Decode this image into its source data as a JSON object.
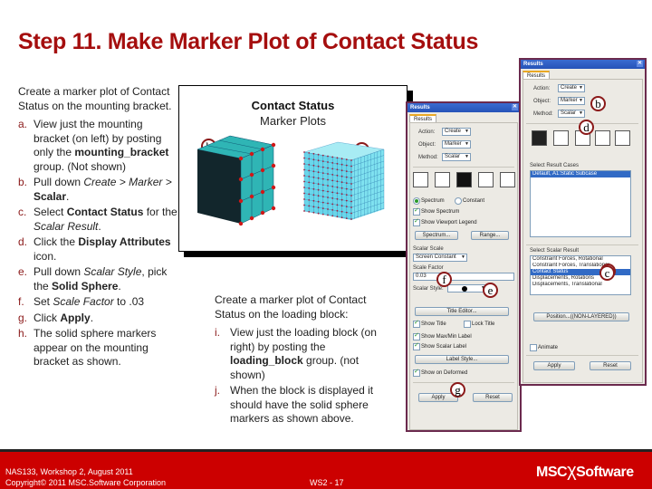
{
  "slide": {
    "title": "Step 11. Make Marker Plot of Contact Status"
  },
  "left": {
    "intro": "Create a marker plot of Contact Status on the mounting bracket.",
    "steps": [
      {
        "letter": "a.",
        "parts": [
          "View just the mounting bracket (on left) by posting only the ",
          "mounting_bracket",
          " group. (Not shown)"
        ]
      },
      {
        "letter": "b.",
        "parts": [
          "Pull down ",
          "Create > Marker >",
          " ",
          "Scalar",
          "."
        ]
      },
      {
        "letter": "c.",
        "parts": [
          "Select ",
          "Contact Status",
          " for the ",
          "Scalar Result",
          "."
        ]
      },
      {
        "letter": "d.",
        "parts": [
          "Click the ",
          "Display Attributes",
          " icon."
        ]
      },
      {
        "letter": "e.",
        "parts": [
          "Pull down ",
          "Scalar Style",
          ", pick the ",
          "Solid Sphere",
          "."
        ]
      },
      {
        "letter": "f.",
        "parts": [
          "Set ",
          "Scale Factor",
          " to .03"
        ]
      },
      {
        "letter": "g.",
        "parts": [
          "Click ",
          "Apply",
          "."
        ]
      },
      {
        "letter": "h.",
        "parts": [
          "The solid sphere markers appear on the mounting bracket as shown."
        ]
      }
    ]
  },
  "figure": {
    "title": "Contact Status",
    "subtitle": "Marker Plots",
    "callout_h": "h",
    "callout_i": "i"
  },
  "right": {
    "intro": "Create a marker plot of Contact Status on the loading block:",
    "steps": [
      {
        "letter": "i.",
        "parts": [
          "View just the loading block (on right) by posting the ",
          "loading_block",
          " group. (not shown)"
        ]
      },
      {
        "letter": "j.",
        "parts": [
          "When the block is displayed it should have the solid sphere markers as shown above."
        ]
      }
    ]
  },
  "panel_front": {
    "window_title": "Results",
    "tab": "Results",
    "action_label": "Action:",
    "action_value": "Create",
    "object_label": "Object:",
    "object_value": "Marker",
    "method_label": "Method:",
    "method_value": "Scalar",
    "result_cases_label": "Select Result Cases",
    "result_cases": [
      "Default, A1:Static Subcase"
    ],
    "scalar_result_label": "Select Scalar Result",
    "scalar_results": [
      "Constraint Forces, Rotational",
      "Constraint Forces, Translational",
      "Contact Status",
      "Displacements, Rotations",
      "Displacements, Translational"
    ],
    "scalar_selected_index": 2,
    "position_button": "Position...((NON-LAYERED))",
    "animate_label": "Animate",
    "apply_button": "Apply",
    "reset_button": "Reset",
    "callout_b": "b",
    "callout_d": "d",
    "callout_c": "c"
  },
  "panel_back": {
    "window_title": "Results",
    "tab": "Results",
    "action_label": "Action:",
    "action_value": "Create",
    "object_label": "Object:",
    "object_value": "Marker",
    "method_label": "Method:",
    "method_value": "Scalar",
    "spectrum_radio": "Spectrum",
    "constant_radio": "Constant",
    "show_spectrum": "Show Spectrum",
    "show_viewport_legend": "Show Viewport Legend",
    "spectrum_button": "Spectrum...",
    "range_button": "Range...",
    "scalar_scale_label": "Scalar Scale",
    "scalar_scale_value": "Screen Constant",
    "scale_factor_label": "Scale Factor",
    "scale_factor_value": "0.03",
    "scalar_style_label": "Scalar Style:",
    "title_editor_button": "Title Editor...",
    "show_title": "Show Title",
    "lock_title": "Lock Title",
    "show_maxmin_label": "Show Max/Min Label",
    "show_scalar_label": "Show Scalar Label",
    "label_style_button": "Label Style...",
    "show_on_deformed": "Show on Deformed",
    "apply_button": "Apply",
    "reset_button": "Reset",
    "callout_f": "f",
    "callout_e": "e",
    "callout_g": "g"
  },
  "footer": {
    "line1": "NAS133, Workshop 2, August 2011",
    "line2": "Copyright© 2011 MSC.Software Corporation",
    "page": "WS2 - 17",
    "logo_left": "MSC",
    "logo_right": "Software",
    "bg_color": "#cc0000"
  }
}
